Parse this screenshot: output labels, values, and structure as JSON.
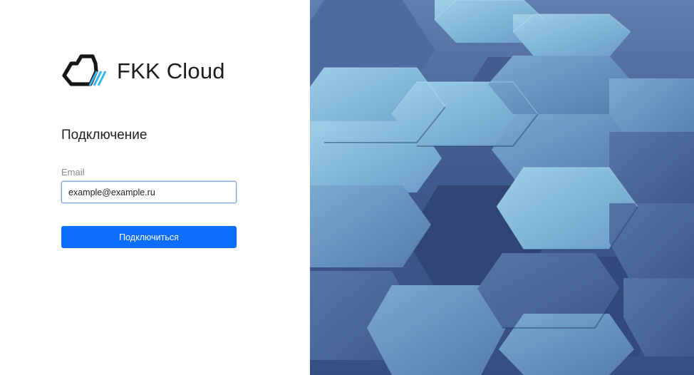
{
  "brand": {
    "name": "FKK Cloud",
    "logo_icon": "cloud-icon",
    "accent_color": "#3ab6ee"
  },
  "login": {
    "heading": "Подключение",
    "email_label": "Email",
    "email_value": "example@example.ru",
    "submit_label": "Подключиться",
    "button_color": "#0d6efd"
  },
  "background": {
    "image": "hexagon-pattern-image"
  }
}
